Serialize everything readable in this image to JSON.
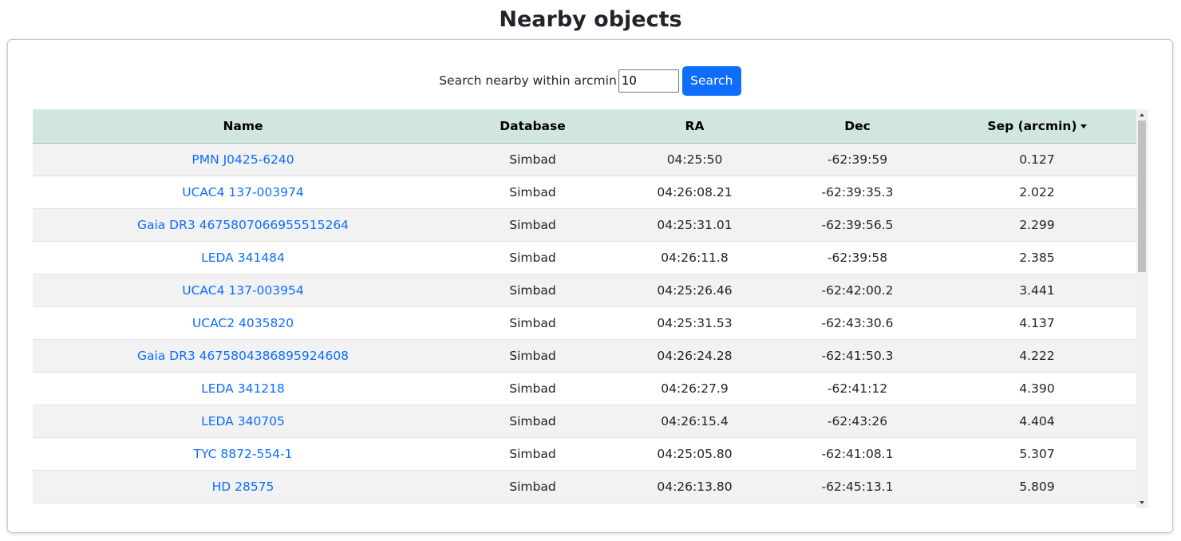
{
  "page": {
    "title": "Nearby objects"
  },
  "search": {
    "label": "Search nearby within arcmin",
    "value": "10",
    "button_label": "Search"
  },
  "table": {
    "columns": [
      "Name",
      "Database",
      "RA",
      "Dec",
      "Sep (arcmin)"
    ],
    "sort_column": "Sep (arcmin)",
    "sort_direction": "descending-caret",
    "rows": [
      {
        "name": "PMN J0425-6240",
        "database": "Simbad",
        "ra": "04:25:50",
        "dec": "-62:39:59",
        "sep": "0.127"
      },
      {
        "name": "UCAC4 137-003974",
        "database": "Simbad",
        "ra": "04:26:08.21",
        "dec": "-62:39:35.3",
        "sep": "2.022"
      },
      {
        "name": "Gaia DR3 4675807066955515264",
        "database": "Simbad",
        "ra": "04:25:31.01",
        "dec": "-62:39:56.5",
        "sep": "2.299"
      },
      {
        "name": "LEDA 341484",
        "database": "Simbad",
        "ra": "04:26:11.8",
        "dec": "-62:39:58",
        "sep": "2.385"
      },
      {
        "name": "UCAC4 137-003954",
        "database": "Simbad",
        "ra": "04:25:26.46",
        "dec": "-62:42:00.2",
        "sep": "3.441"
      },
      {
        "name": "UCAC2 4035820",
        "database": "Simbad",
        "ra": "04:25:31.53",
        "dec": "-62:43:30.6",
        "sep": "4.137"
      },
      {
        "name": "Gaia DR3 4675804386895924608",
        "database": "Simbad",
        "ra": "04:26:24.28",
        "dec": "-62:41:50.3",
        "sep": "4.222"
      },
      {
        "name": "LEDA 341218",
        "database": "Simbad",
        "ra": "04:26:27.9",
        "dec": "-62:41:12",
        "sep": "4.390"
      },
      {
        "name": "LEDA 340705",
        "database": "Simbad",
        "ra": "04:26:15.4",
        "dec": "-62:43:26",
        "sep": "4.404"
      },
      {
        "name": "TYC 8872-554-1",
        "database": "Simbad",
        "ra": "04:25:05.80",
        "dec": "-62:41:08.1",
        "sep": "5.307"
      },
      {
        "name": "HD 28575",
        "database": "Simbad",
        "ra": "04:26:13.80",
        "dec": "-62:45:13.1",
        "sep": "5.809"
      }
    ]
  },
  "colors": {
    "header_bg": "#d1e7dd",
    "link": "#0d6efd",
    "button": "#0d6efd",
    "stripe": "#f2f2f2"
  }
}
